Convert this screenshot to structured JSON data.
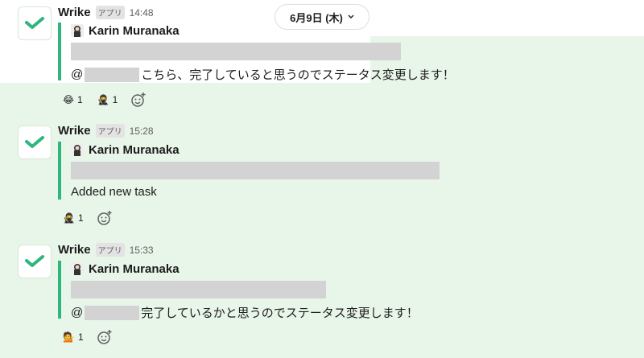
{
  "date_divider": {
    "label": "6月9日 (木)"
  },
  "messages": [
    {
      "sender": "Wrike",
      "app_badge": "アプリ",
      "time": "14:48",
      "author": "Karin Muranaka",
      "text_prefix": "@",
      "text": "こちら、完了していると思うのでステータス変更します！",
      "reactions": [
        {
          "emoji": "😂",
          "count": "1"
        },
        {
          "emoji": "🥷",
          "count": "1"
        }
      ]
    },
    {
      "sender": "Wrike",
      "app_badge": "アプリ",
      "time": "15:28",
      "author": "Karin Muranaka",
      "text": "Added new task",
      "reactions": [
        {
          "emoji": "🥷",
          "count": "1"
        }
      ]
    },
    {
      "sender": "Wrike",
      "app_badge": "アプリ",
      "time": "15:33",
      "author": "Karin Muranaka",
      "text_prefix": "@",
      "text": "完了しているかと思うのでステータス変更します！",
      "reactions": [
        {
          "emoji": "💁",
          "count": "1"
        }
      ]
    }
  ],
  "colors": {
    "brand": "#2eb67d",
    "highlight_bg": "#e8f5e9"
  }
}
